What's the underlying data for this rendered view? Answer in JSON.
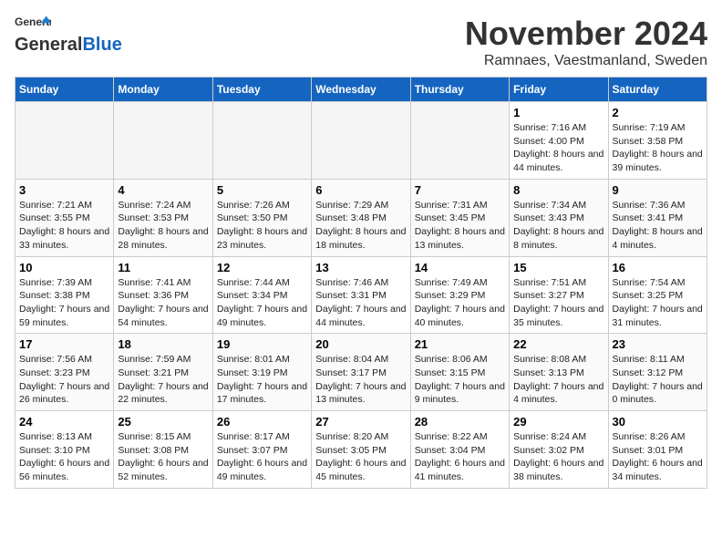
{
  "header": {
    "logo_general": "General",
    "logo_blue": "Blue",
    "month_title": "November 2024",
    "location": "Ramnaes, Vaestmanland, Sweden"
  },
  "weekdays": [
    "Sunday",
    "Monday",
    "Tuesday",
    "Wednesday",
    "Thursday",
    "Friday",
    "Saturday"
  ],
  "weeks": [
    [
      {
        "day": "",
        "info": ""
      },
      {
        "day": "",
        "info": ""
      },
      {
        "day": "",
        "info": ""
      },
      {
        "day": "",
        "info": ""
      },
      {
        "day": "",
        "info": ""
      },
      {
        "day": "1",
        "info": "Sunrise: 7:16 AM\nSunset: 4:00 PM\nDaylight: 8 hours and 44 minutes."
      },
      {
        "day": "2",
        "info": "Sunrise: 7:19 AM\nSunset: 3:58 PM\nDaylight: 8 hours and 39 minutes."
      }
    ],
    [
      {
        "day": "3",
        "info": "Sunrise: 7:21 AM\nSunset: 3:55 PM\nDaylight: 8 hours and 33 minutes."
      },
      {
        "day": "4",
        "info": "Sunrise: 7:24 AM\nSunset: 3:53 PM\nDaylight: 8 hours and 28 minutes."
      },
      {
        "day": "5",
        "info": "Sunrise: 7:26 AM\nSunset: 3:50 PM\nDaylight: 8 hours and 23 minutes."
      },
      {
        "day": "6",
        "info": "Sunrise: 7:29 AM\nSunset: 3:48 PM\nDaylight: 8 hours and 18 minutes."
      },
      {
        "day": "7",
        "info": "Sunrise: 7:31 AM\nSunset: 3:45 PM\nDaylight: 8 hours and 13 minutes."
      },
      {
        "day": "8",
        "info": "Sunrise: 7:34 AM\nSunset: 3:43 PM\nDaylight: 8 hours and 8 minutes."
      },
      {
        "day": "9",
        "info": "Sunrise: 7:36 AM\nSunset: 3:41 PM\nDaylight: 8 hours and 4 minutes."
      }
    ],
    [
      {
        "day": "10",
        "info": "Sunrise: 7:39 AM\nSunset: 3:38 PM\nDaylight: 7 hours and 59 minutes."
      },
      {
        "day": "11",
        "info": "Sunrise: 7:41 AM\nSunset: 3:36 PM\nDaylight: 7 hours and 54 minutes."
      },
      {
        "day": "12",
        "info": "Sunrise: 7:44 AM\nSunset: 3:34 PM\nDaylight: 7 hours and 49 minutes."
      },
      {
        "day": "13",
        "info": "Sunrise: 7:46 AM\nSunset: 3:31 PM\nDaylight: 7 hours and 44 minutes."
      },
      {
        "day": "14",
        "info": "Sunrise: 7:49 AM\nSunset: 3:29 PM\nDaylight: 7 hours and 40 minutes."
      },
      {
        "day": "15",
        "info": "Sunrise: 7:51 AM\nSunset: 3:27 PM\nDaylight: 7 hours and 35 minutes."
      },
      {
        "day": "16",
        "info": "Sunrise: 7:54 AM\nSunset: 3:25 PM\nDaylight: 7 hours and 31 minutes."
      }
    ],
    [
      {
        "day": "17",
        "info": "Sunrise: 7:56 AM\nSunset: 3:23 PM\nDaylight: 7 hours and 26 minutes."
      },
      {
        "day": "18",
        "info": "Sunrise: 7:59 AM\nSunset: 3:21 PM\nDaylight: 7 hours and 22 minutes."
      },
      {
        "day": "19",
        "info": "Sunrise: 8:01 AM\nSunset: 3:19 PM\nDaylight: 7 hours and 17 minutes."
      },
      {
        "day": "20",
        "info": "Sunrise: 8:04 AM\nSunset: 3:17 PM\nDaylight: 7 hours and 13 minutes."
      },
      {
        "day": "21",
        "info": "Sunrise: 8:06 AM\nSunset: 3:15 PM\nDaylight: 7 hours and 9 minutes."
      },
      {
        "day": "22",
        "info": "Sunrise: 8:08 AM\nSunset: 3:13 PM\nDaylight: 7 hours and 4 minutes."
      },
      {
        "day": "23",
        "info": "Sunrise: 8:11 AM\nSunset: 3:12 PM\nDaylight: 7 hours and 0 minutes."
      }
    ],
    [
      {
        "day": "24",
        "info": "Sunrise: 8:13 AM\nSunset: 3:10 PM\nDaylight: 6 hours and 56 minutes."
      },
      {
        "day": "25",
        "info": "Sunrise: 8:15 AM\nSunset: 3:08 PM\nDaylight: 6 hours and 52 minutes."
      },
      {
        "day": "26",
        "info": "Sunrise: 8:17 AM\nSunset: 3:07 PM\nDaylight: 6 hours and 49 minutes."
      },
      {
        "day": "27",
        "info": "Sunrise: 8:20 AM\nSunset: 3:05 PM\nDaylight: 6 hours and 45 minutes."
      },
      {
        "day": "28",
        "info": "Sunrise: 8:22 AM\nSunset: 3:04 PM\nDaylight: 6 hours and 41 minutes."
      },
      {
        "day": "29",
        "info": "Sunrise: 8:24 AM\nSunset: 3:02 PM\nDaylight: 6 hours and 38 minutes."
      },
      {
        "day": "30",
        "info": "Sunrise: 8:26 AM\nSunset: 3:01 PM\nDaylight: 6 hours and 34 minutes."
      }
    ]
  ]
}
